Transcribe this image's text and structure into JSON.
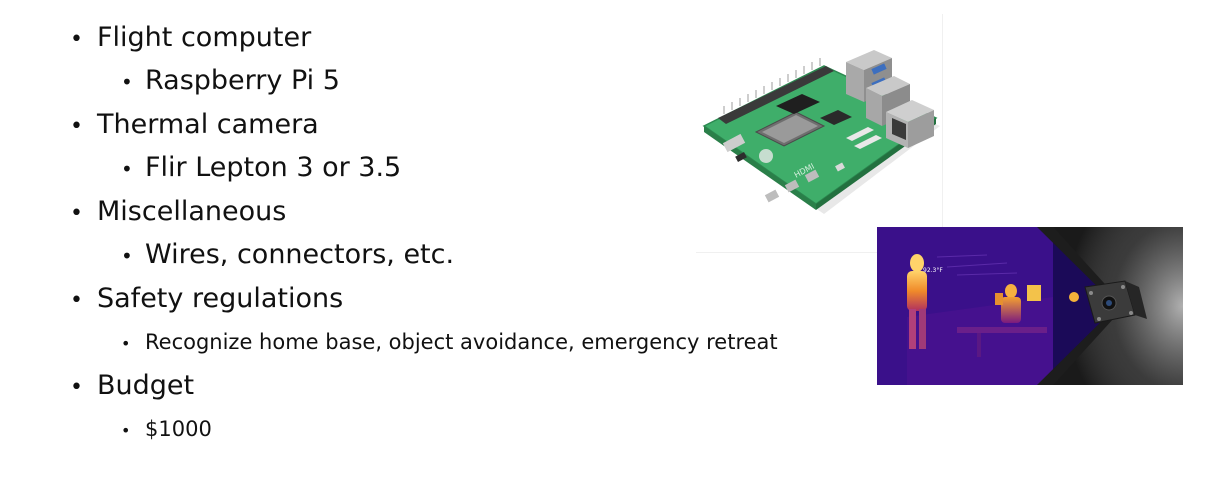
{
  "bullets": [
    {
      "label": "Flight computer",
      "sub": [
        {
          "label": "Raspberry Pi 5"
        }
      ]
    },
    {
      "label": "Thermal camera",
      "sub": [
        {
          "label": "Flir Lepton 3 or 3.5"
        }
      ]
    },
    {
      "label": "Miscellaneous",
      "sub": [
        {
          "label": "Wires, connectors, etc."
        }
      ]
    },
    {
      "label": "Safety regulations",
      "sub": [
        {
          "label": "Recognize home base, object avoidance, emergency retreat"
        }
      ]
    },
    {
      "label": "Budget",
      "sub": [
        {
          "label": "$1000"
        }
      ]
    }
  ],
  "bullet_char": "•",
  "thermal_photo": {
    "temperature_readout": "92.3°F"
  },
  "pi_photo": {
    "board_print": "HDMI"
  },
  "colors": {
    "text": "#111111",
    "board_green": "#3fae6a",
    "thermal_bg": "#1b0a58"
  }
}
